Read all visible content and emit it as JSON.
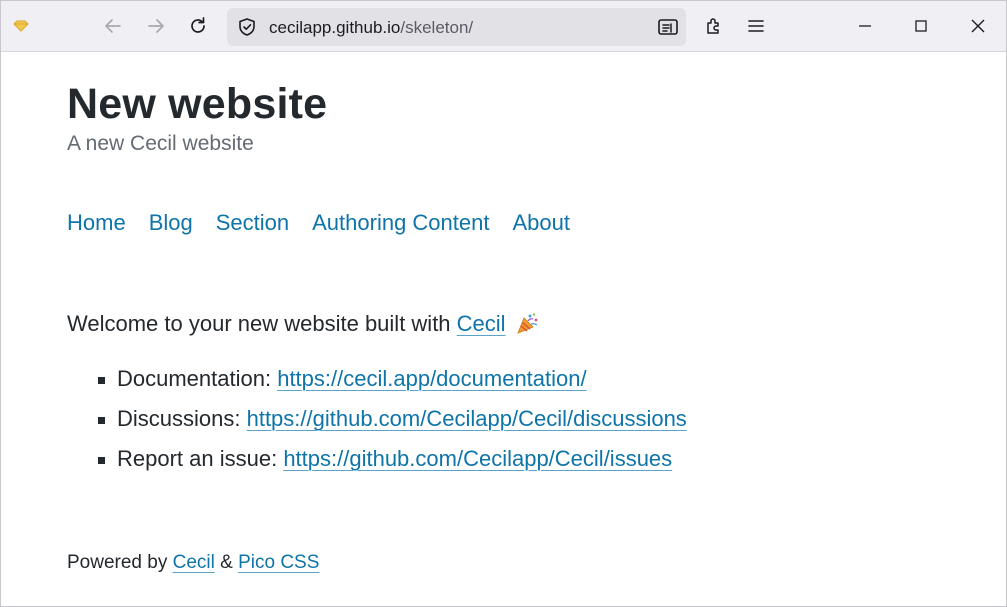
{
  "browser": {
    "url_host": "cecilapp.github.io",
    "url_path": "/skeleton/",
    "icons": [
      "favicon",
      "back-icon",
      "forward-icon",
      "reload-icon",
      "shield-icon",
      "reader-view-icon",
      "extensions-icon",
      "menu-icon",
      "minimize-icon",
      "maximize-icon",
      "close-icon"
    ]
  },
  "site": {
    "title": "New website",
    "subtitle": "A new Cecil website"
  },
  "nav": {
    "items": [
      "Home",
      "Blog",
      "Section",
      "Authoring Content",
      "About"
    ]
  },
  "content": {
    "welcome_text": "Welcome to your new website built with ",
    "welcome_link": "Cecil",
    "list": [
      {
        "label": "Documentation: ",
        "link": "https://cecil.app/documentation/"
      },
      {
        "label": "Discussions: ",
        "link": "https://github.com/Cecilapp/Cecil/discussions"
      },
      {
        "label": "Report an issue: ",
        "link": "https://github.com/Cecilapp/Cecil/issues"
      }
    ]
  },
  "footer": {
    "prefix": "Powered by ",
    "link1": "Cecil",
    "sep": " & ",
    "link2": "Pico CSS"
  },
  "colors": {
    "link": "#0f74a8",
    "text": "#24292e",
    "muted": "#646b73"
  }
}
